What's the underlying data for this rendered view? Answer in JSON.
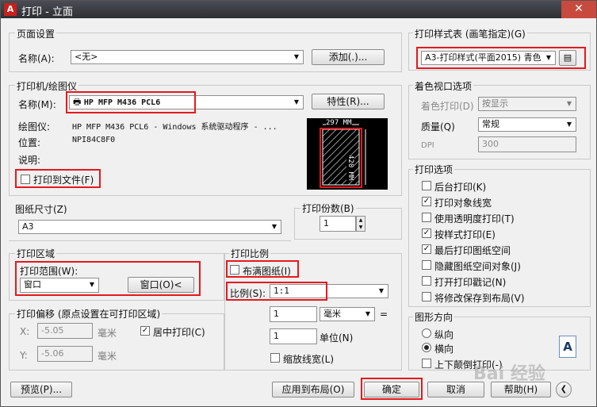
{
  "window": {
    "title": "打印 - 立面",
    "close_glyph": "✕",
    "app_glyph": "A"
  },
  "page_setup": {
    "section": "页面设置",
    "name_label": "名称(A):",
    "name_value": "<无>",
    "add_button": "添加(.)..."
  },
  "printer": {
    "section": "打印机/绘图仪",
    "name_label": "名称(M):",
    "name_value": "HP MFP M436 PCL6",
    "properties_button": "特性(R)...",
    "plotter_label": "绘图仪:",
    "plotter_value": "HP MFP M436 PCL6 - Windows 系统驱动程序 - ...",
    "location_label": "位置:",
    "location_value": "NPI84C8F0",
    "desc_label": "说明:",
    "print_to_file": "打印到文件(F)",
    "preview_width": "297 MM",
    "preview_height": "420 MM"
  },
  "paper_size": {
    "section": "图纸尺寸(Z)",
    "value": "A3"
  },
  "copies": {
    "section": "打印份数(B)",
    "value": "1"
  },
  "plot_area": {
    "section": "打印区域",
    "range_label": "打印范围(W):",
    "range_value": "窗口",
    "window_button": "窗口(O)<"
  },
  "plot_offset": {
    "section": "打印偏移 (原点设置在可打印区域)",
    "x_label": "X:",
    "x_value": "-5.05",
    "x_unit": "毫米",
    "y_label": "Y:",
    "y_value": "-5.06",
    "y_unit": "毫米",
    "center_label": "居中打印(C)"
  },
  "plot_scale": {
    "section": "打印比例",
    "fit_label": "布满图纸(I)",
    "scale_label": "比例(S):",
    "scale_value": "1:1",
    "units_value": "1",
    "units_unit": "毫米",
    "eq": "=",
    "drawing_units_value": "1",
    "drawing_units_label": "单位(N)",
    "scale_lineweights": "缩放线宽(L)"
  },
  "style_table": {
    "section": "打印样式表 (画笔指定)(G)",
    "value": "A3-打印样式(平面2015) 青色"
  },
  "shaded": {
    "section": "着色视口选项",
    "shade_label": "着色打印(D)",
    "shade_value": "按显示",
    "quality_label": "质量(Q)",
    "quality_value": "常规",
    "dpi_label": "DPI",
    "dpi_value": "300"
  },
  "options": {
    "section": "打印选项",
    "items": [
      {
        "label": "后台打印(K)",
        "checked": false
      },
      {
        "label": "打印对象线宽",
        "checked": true
      },
      {
        "label": "使用透明度打印(T)",
        "checked": false
      },
      {
        "label": "按样式打印(E)",
        "checked": true
      },
      {
        "label": "最后打印图纸空间",
        "checked": true
      },
      {
        "label": "隐藏图纸空间对象(J)",
        "checked": false
      },
      {
        "label": "打开打印戳记(N)",
        "checked": false
      },
      {
        "label": "将修改保存到布局(V)",
        "checked": false
      }
    ]
  },
  "orientation": {
    "section": "图形方向",
    "portrait": "纵向",
    "landscape": "横向",
    "upside_down": "上下颠倒打印(-)",
    "glyph": "A"
  },
  "bottom": {
    "preview": "预览(P)...",
    "apply": "应用到布局(O)",
    "ok": "确定",
    "cancel": "取消",
    "help": "帮助(H)",
    "watermark": "Bai 经验"
  }
}
